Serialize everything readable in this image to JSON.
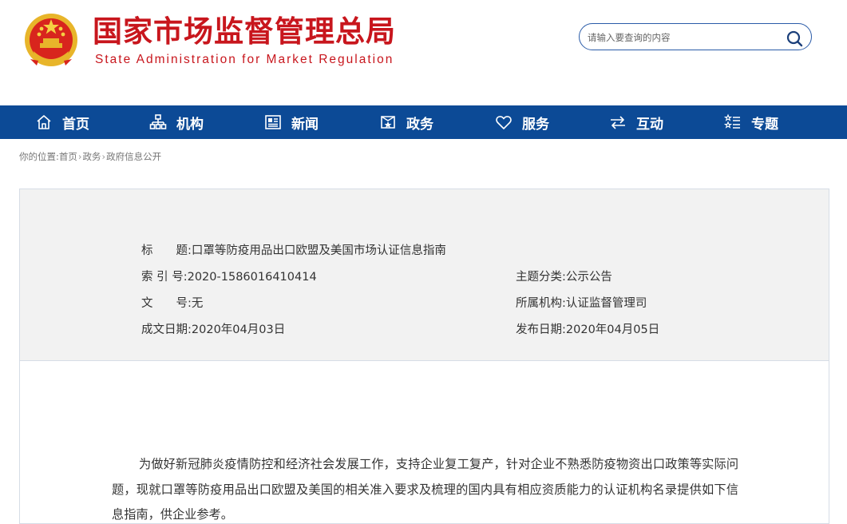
{
  "header": {
    "title": "国家市场监督管理总局",
    "subtitle": "State Administration for Market Regulation",
    "search": {
      "placeholder": "请输入要查询的内容",
      "value": ""
    }
  },
  "nav": {
    "items": [
      {
        "label": "首页",
        "icon": "home-icon"
      },
      {
        "label": "机构",
        "icon": "org-icon"
      },
      {
        "label": "新闻",
        "icon": "news-icon"
      },
      {
        "label": "政务",
        "icon": "affairs-icon"
      },
      {
        "label": "服务",
        "icon": "heart-icon"
      },
      {
        "label": "互动",
        "icon": "swap-icon"
      },
      {
        "label": "专题",
        "icon": "topic-icon"
      }
    ]
  },
  "breadcrumb": {
    "prefix": "你的位置:",
    "items": [
      "首页",
      "政务",
      "政府信息公开"
    ],
    "separator": "›"
  },
  "info": {
    "title_key": "标　　题:",
    "title_value": "口罩等防疫用品出口欧盟及美国市场认证信息指南",
    "index_key": "索 引 号:",
    "index_value": "2020-1586016410414",
    "category_key": "主题分类:",
    "category_value": "公示公告",
    "doc_key": "文　　号:",
    "doc_value": "无",
    "org_key": "所属机构:",
    "org_value": "认证监督管理司",
    "created_key": "成文日期:",
    "created_value": "2020年04月03日",
    "published_key": "发布日期:",
    "published_value": "2020年04月05日"
  },
  "content": {
    "paragraph": "为做好新冠肺炎疫情防控和经济社会发展工作，支持企业复工复产，针对企业不熟悉防疫物资出口政策等实际问题，现就口罩等防疫用品出口欧盟及美国的相关准入要求及梳理的国内具有相应资质能力的认证机构名录提供如下信息指南，供企业参考。"
  },
  "colors": {
    "brand_red": "#c8161d",
    "nav_blue": "#0c4a96",
    "search_border": "#2a5ba8"
  }
}
